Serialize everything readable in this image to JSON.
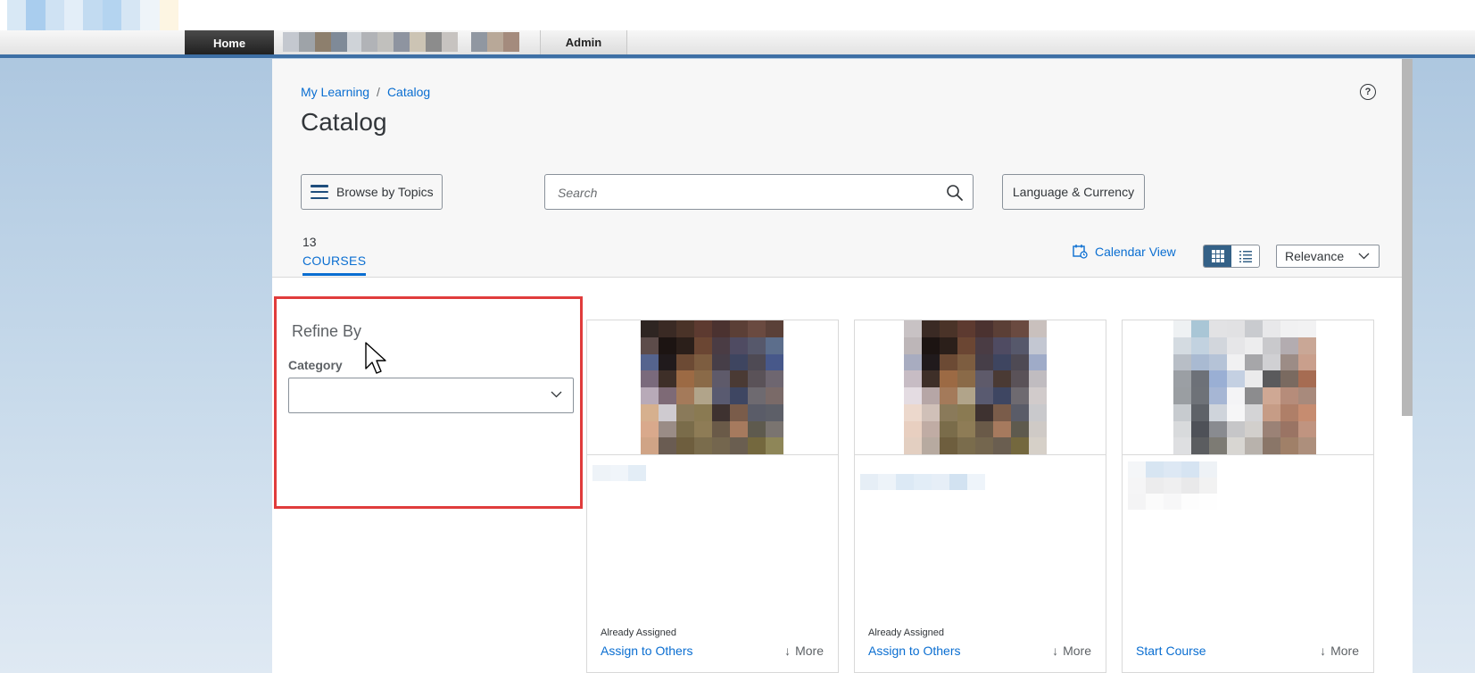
{
  "nav": {
    "home_label": "Home",
    "admin_label": "Admin"
  },
  "breadcrumb": {
    "items": [
      "My Learning",
      "Catalog"
    ],
    "separator": "/"
  },
  "page": {
    "title": "Catalog"
  },
  "toolbar": {
    "browse_label": "Browse by Topics",
    "search_placeholder": "Search",
    "search_value": "",
    "language_label": "Language & Currency"
  },
  "results": {
    "count": "13",
    "tab_label": "COURSES",
    "calendar_view_label": "Calendar View",
    "view_mode": "grid",
    "sort_selected": "Relevance"
  },
  "refine": {
    "title": "Refine By",
    "category_label": "Category",
    "category_value": ""
  },
  "cards": [
    {
      "status": "Already Assigned",
      "action": "Assign to Others",
      "more": "More"
    },
    {
      "status": "Already Assigned",
      "action": "Assign to Others",
      "more": "More"
    },
    {
      "status": "",
      "action": "Start Course",
      "more": "More"
    }
  ],
  "colors": {
    "accent": "#0a6ed1",
    "highlight_border": "#e03c3c",
    "nav_bar": "#3d6fa5",
    "toggle_active": "#346187"
  }
}
